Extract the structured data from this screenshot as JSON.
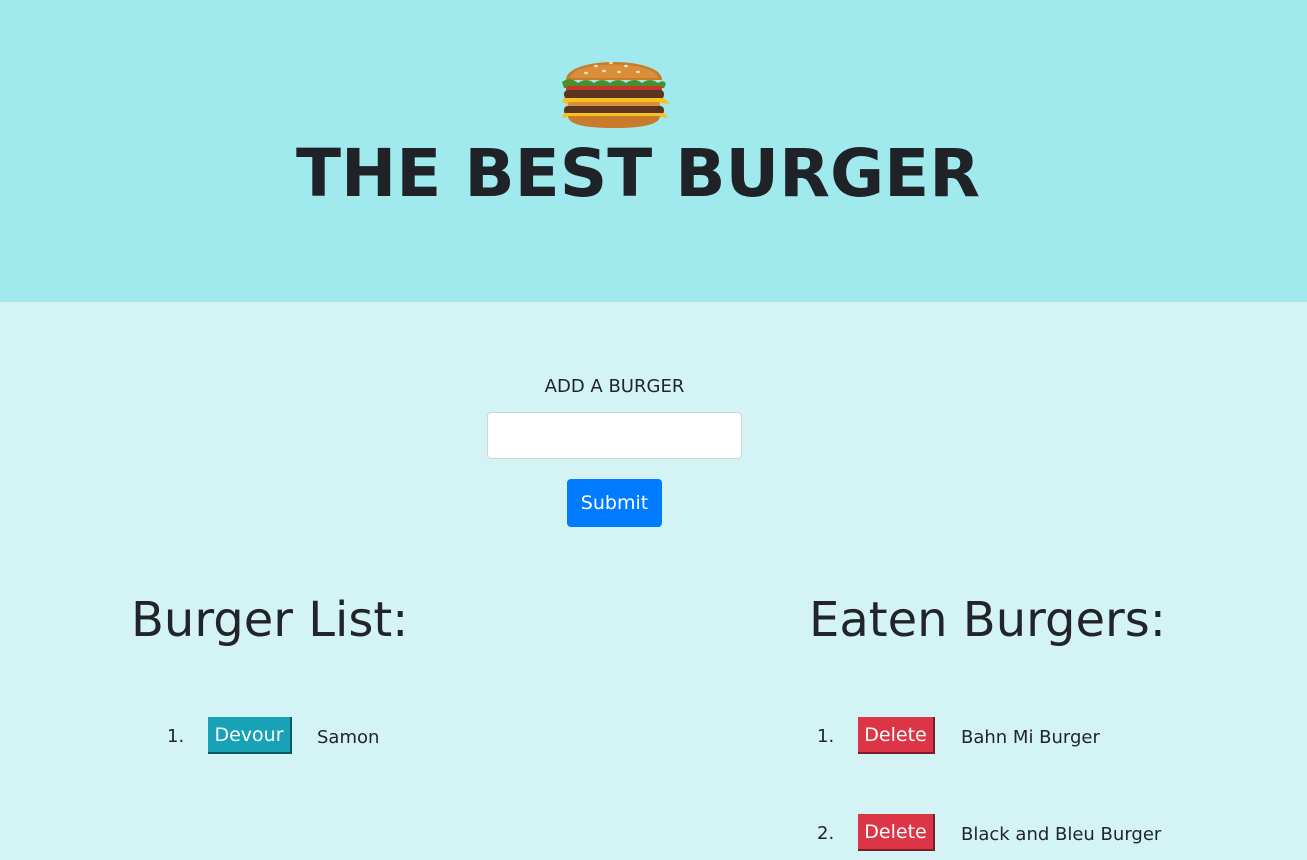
{
  "header": {
    "title": "THE BEST BURGER",
    "logo_icon": "burger-icon",
    "background_color": "#a0eaed"
  },
  "form": {
    "label": "ADD A BURGER",
    "input_value": "",
    "input_placeholder": "",
    "submit_label": "Submit",
    "submit_color": "#007bff"
  },
  "burger_list": {
    "heading": "Burger List:",
    "items": [
      {
        "number": "1.",
        "button_label": "Devour",
        "name": "Samon"
      }
    ],
    "button_color": "#17a2b8"
  },
  "eaten_burgers": {
    "heading": "Eaten Burgers:",
    "items": [
      {
        "number": "1.",
        "button_label": "Delete",
        "name": "Bahn Mi Burger"
      },
      {
        "number": "2.",
        "button_label": "Delete",
        "name": "Black and Bleu Burger"
      }
    ],
    "button_color": "#dc3545"
  }
}
